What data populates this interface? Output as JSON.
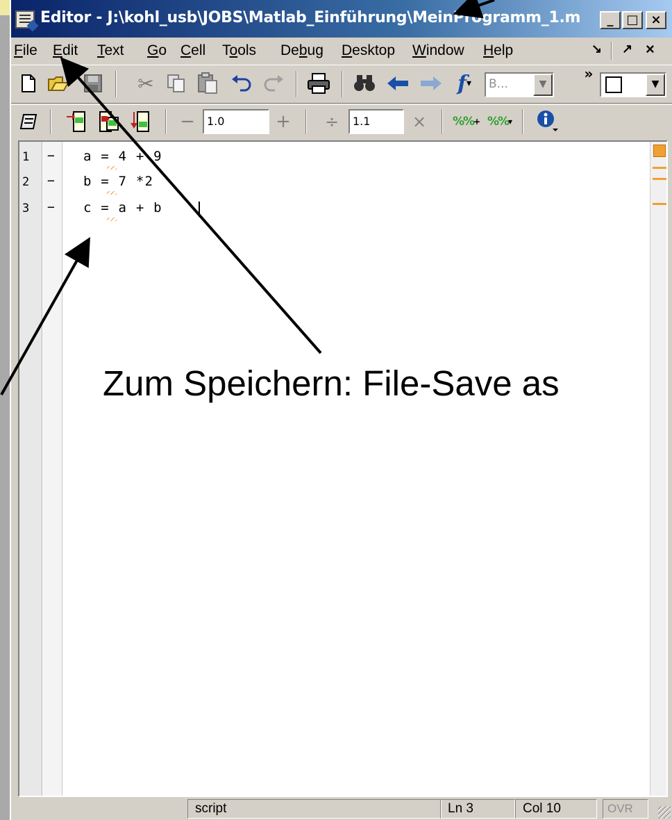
{
  "window": {
    "title": "Editor - J:\\kohl_usb\\JOBS\\Matlab_Einführung\\MeinProgramm_1.m",
    "minimize_glyph": "_",
    "maximize_glyph": "□",
    "close_glyph": "×"
  },
  "menu": {
    "items": [
      {
        "label_u": "F",
        "label_rest": "ile"
      },
      {
        "label_u": "E",
        "label_rest": "dit"
      },
      {
        "label_u": "T",
        "label_rest": "ext"
      },
      {
        "label_u": "G",
        "label_rest": "o"
      },
      {
        "label_u": "C",
        "label_rest": "ell"
      },
      {
        "label_pre": "T",
        "label_u": "o",
        "label_rest": "ols"
      },
      {
        "label_pre": "De",
        "label_u": "b",
        "label_rest": "ug"
      },
      {
        "label_u": "D",
        "label_rest": "esktop"
      },
      {
        "label_u": "W",
        "label_rest": "indow"
      },
      {
        "label_u": "H",
        "label_rest": "elp"
      }
    ],
    "dock_glyph": "↘",
    "undock_glyph": "↗",
    "close_glyph": "×"
  },
  "toolbar1": {
    "stack_field": "B...",
    "more_glyph": "»"
  },
  "toolbar2": {
    "cell_minus": "−",
    "cell_value1": "1.0",
    "cell_plus": "+",
    "cell_divide": "÷",
    "cell_value2": "1.1",
    "cell_times": "×"
  },
  "editor": {
    "lines": [
      {
        "num": "1",
        "dash": "−",
        "code": "a = 4 + 9"
      },
      {
        "num": "2",
        "dash": "−",
        "code": "b = 7 *2"
      },
      {
        "num": "3",
        "dash": "−",
        "code": "c = a + b"
      }
    ]
  },
  "statusbar": {
    "mode": "script",
    "line": "Ln  3",
    "col": "Col  10",
    "ovr": "OVR"
  },
  "annotation": {
    "text": "Zum Speichern: File-Save as"
  },
  "colors": {
    "titlebar_start": "#0a246a",
    "titlebar_end": "#a6caf0",
    "chrome": "#d4d0c8",
    "mlint_warning": "#f0a030"
  }
}
